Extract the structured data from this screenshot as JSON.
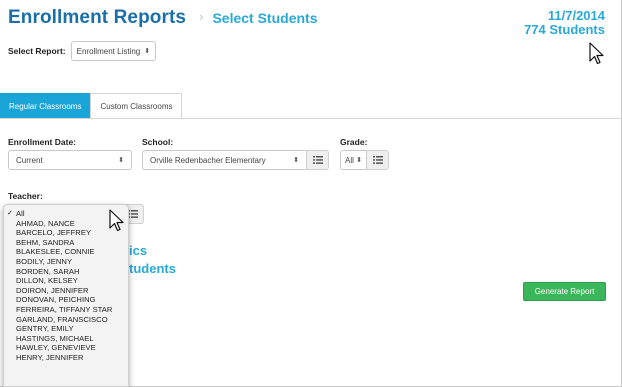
{
  "header": {
    "title": "Enrollment Reports",
    "separator": "›",
    "subtitle": "Select Students",
    "date": "11/7/2014",
    "student_count": "774 Students"
  },
  "report_select": {
    "label": "Select Report:",
    "value": "Enrollment Listing"
  },
  "tabs": [
    {
      "label": "Regular Classrooms",
      "active": true
    },
    {
      "label": "Custom Classrooms",
      "active": false
    }
  ],
  "filters": {
    "enrollment_date": {
      "label": "Enrollment Date:",
      "value": "Current"
    },
    "school": {
      "label": "School:",
      "value": "Orville Redenbacher Elementary"
    },
    "grade": {
      "label": "Grade:",
      "value": "All"
    },
    "teacher": {
      "label": "Teacher:"
    }
  },
  "background_text": {
    "line1": "ics",
    "line2": "tudents"
  },
  "generate_button": "Generate Report",
  "teacher_dropdown": {
    "selected": "All",
    "options": [
      "All",
      "AHMAD, NANCE",
      "BARCELO, JEFFREY",
      "BEHM, SANDRA",
      "BLAKESLEE, CONNIE",
      "BODILY, JENNY",
      "BORDEN, SARAH",
      "DILLON, KELSEY",
      "DOIRON, JENNIFER",
      "DONOVAN, PEICHING",
      "FERREIRA, TIFFANY STAR",
      "GARLAND, FRANSCISCO",
      "GENTRY, EMILY",
      "HASTINGS, MICHAEL",
      "HAWLEY, GENEVIEVE",
      "HENRY, JENNIFER"
    ]
  },
  "icons": {
    "select_arrows": "updown-arrows-icon",
    "list_button": "list-icon",
    "cursor": "mouse-pointer-icon",
    "check": "checkmark-icon"
  },
  "colors": {
    "title": "#1b6fa8",
    "accent": "#29a9d8",
    "active_tab": "#1aa5d9",
    "generate_button": "#3bb65a"
  }
}
